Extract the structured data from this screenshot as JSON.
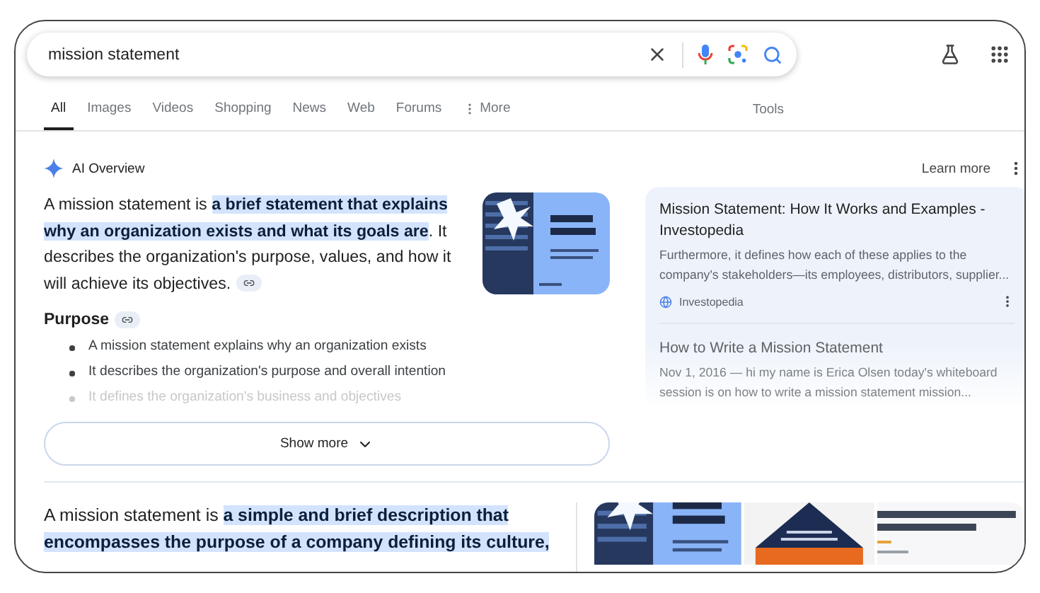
{
  "search": {
    "value": "mission statement"
  },
  "tabs": [
    {
      "label": "All",
      "selected": true
    },
    {
      "label": "Images",
      "selected": false
    },
    {
      "label": "Videos",
      "selected": false
    },
    {
      "label": "Shopping",
      "selected": false
    },
    {
      "label": "News",
      "selected": false
    },
    {
      "label": "Web",
      "selected": false
    },
    {
      "label": "Forums",
      "selected": false
    },
    {
      "label": "More",
      "selected": false,
      "kind": "menu"
    }
  ],
  "tools": "Tools",
  "ai_overview": {
    "title": "AI Overview",
    "learn_more": "Learn more",
    "summary": [
      {
        "text": "A mission statement is ",
        "highlight": false
      },
      {
        "text": "a brief statement that explains why an organization exists and what its goals are",
        "highlight": true
      },
      {
        "text": ". It describes the organization's purpose, values, and how it will achieve its objectives.",
        "highlight": false
      }
    ],
    "heading": "Purpose",
    "bullets": [
      {
        "text": "A mission statement explains why an organization exists",
        "faded": false
      },
      {
        "text": "It describes the organization's purpose and overall intention",
        "faded": false
      },
      {
        "text": "It defines the organization's business and objectives",
        "faded": true
      }
    ],
    "show_more": "Show more",
    "sources": [
      {
        "title": "Mission Statement: How It Works and Examples - Investopedia",
        "snippet": "Furthermore, it defines how each of these applies to the company's stakeholders—its employees, distributors, supplier...",
        "site": "Investopedia",
        "faded": false
      },
      {
        "title": "How to Write a Mission Statement",
        "snippet": "Nov 1, 2016 — hi my name is Erica Olsen today's whiteboard session is on how to write a mission statement mission...",
        "faded": true
      }
    ]
  },
  "result": {
    "summary": [
      {
        "text": "A mission statement is ",
        "highlight": false
      },
      {
        "text": "a simple and brief description that encompasses the purpose of a company defining its culture,",
        "highlight": true
      }
    ]
  }
}
